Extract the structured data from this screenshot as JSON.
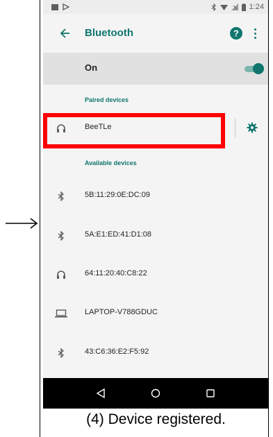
{
  "status_bar": {
    "time": "1:24",
    "icons": [
      "notification-image-icon",
      "notification-play-icon",
      "bluetooth-icon",
      "wifi-icon",
      "no-sim-icon",
      "battery-icon"
    ]
  },
  "app_bar": {
    "title": "Bluetooth",
    "back_icon": "arrow-back-icon",
    "help_icon": "help-icon",
    "more_icon": "more-vert-icon"
  },
  "toggle_row": {
    "label": "On",
    "state": "on"
  },
  "paired_section": {
    "header": "Paired devices",
    "devices": [
      {
        "name": "BeeTLe",
        "icon": "headphones-icon"
      }
    ]
  },
  "available_section": {
    "header": "Available devices",
    "devices": [
      {
        "name": "5B:11:29:0E:DC:09",
        "icon": "bluetooth-icon"
      },
      {
        "name": "5A:E1:ED:41:D1:08",
        "icon": "bluetooth-icon"
      },
      {
        "name": "64:11:20:40:C8:22",
        "icon": "headphones-icon"
      },
      {
        "name": "LAPTOP-V788GDUC",
        "icon": "laptop-icon"
      },
      {
        "name": "43:C6:36:E2:F5:92",
        "icon": "bluetooth-icon"
      }
    ]
  },
  "nav_bar": [
    "back-triangle-icon",
    "home-circle-icon",
    "recents-square-icon"
  ],
  "caption": "(4) Device registered.",
  "colors": {
    "accent": "#0f766e",
    "highlight": "#ff0000"
  }
}
